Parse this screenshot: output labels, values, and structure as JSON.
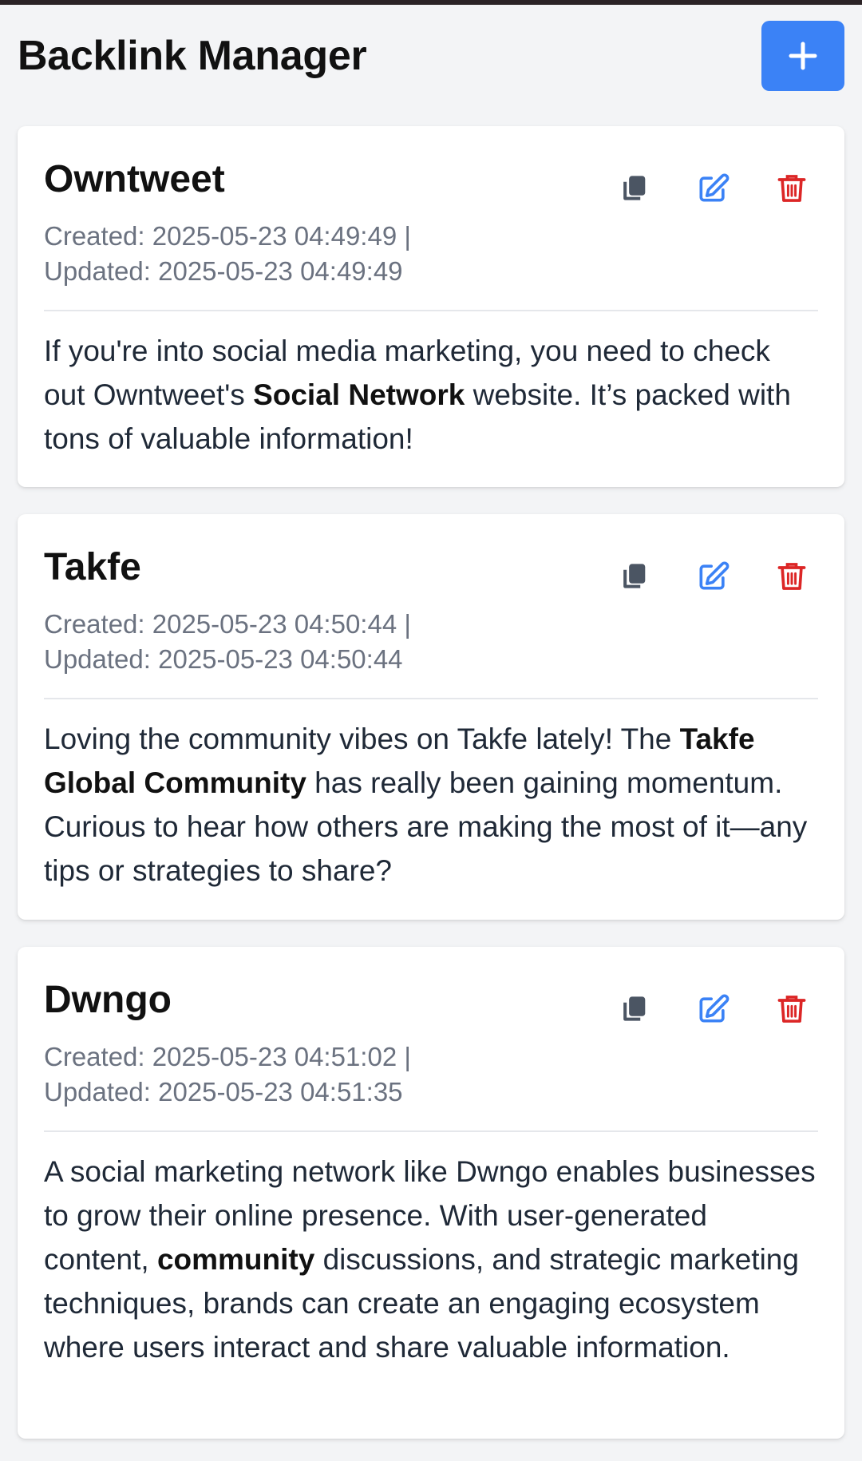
{
  "header": {
    "title": "Backlink Manager",
    "add_icon": "plus-icon"
  },
  "colors": {
    "accent": "#3b82f6",
    "copy_icon": "#4b5563",
    "edit_icon": "#3b82f6",
    "delete_icon": "#dc2626"
  },
  "cards": [
    {
      "title": "Owntweet",
      "created_label": "Created:",
      "created": "2025-05-23 04:49:49",
      "separator": "|",
      "updated_label": "Updated:",
      "updated": "2025-05-23 04:49:49",
      "body": {
        "before": "If you're into social media marketing, you need to check out Owntweet's ",
        "bold": "Social Network",
        "after": " website. It’s packed with tons of valuable information!"
      }
    },
    {
      "title": "Takfe",
      "created_label": "Created:",
      "created": "2025-05-23 04:50:44",
      "separator": "|",
      "updated_label": "Updated:",
      "updated": "2025-05-23 04:50:44",
      "body": {
        "before": "Loving the community vibes on Takfe lately! The ",
        "bold": "Takfe Global Community",
        "after": " has really been gaining momentum. Curious to hear how others are making the most of it—any tips or strategies to share?"
      }
    },
    {
      "title": "Dwngo",
      "created_label": "Created:",
      "created": "2025-05-23 04:51:02",
      "separator": "|",
      "updated_label": "Updated:",
      "updated": "2025-05-23 04:51:35",
      "body": {
        "before": "A social marketing network like Dwngo enables businesses to grow their online presence. With user-generated content, ",
        "bold": "community",
        "after": " discussions, and strategic marketing techniques, brands can create an engaging ecosystem where users interact and share valuable information."
      }
    }
  ]
}
